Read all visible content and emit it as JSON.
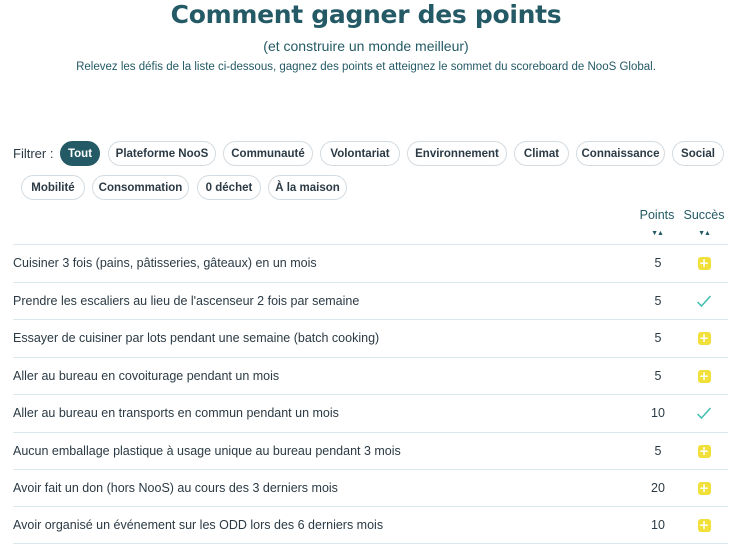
{
  "header": {
    "title": "Comment gagner des points",
    "subtitle": "(et construire un monde meilleur)",
    "description": "Relevez les défis de la liste ci-dessous, gagnez des points et atteignez le sommet du scoreboard de NooS Global."
  },
  "filter": {
    "label": "Filtrer :",
    "chips": [
      {
        "label": "Tout",
        "active": true
      },
      {
        "label": "Plateforme NooS"
      },
      {
        "label": "Communauté"
      },
      {
        "label": "Volontariat"
      },
      {
        "label": "Environnement"
      },
      {
        "label": "Climat"
      },
      {
        "label": "Connaissance"
      },
      {
        "label": "Social"
      },
      {
        "label": "Mobilité"
      },
      {
        "label": "Consommation"
      },
      {
        "label": "0 déchet"
      },
      {
        "label": "À la maison"
      }
    ]
  },
  "table": {
    "col_points": "Points",
    "col_success": "Succès",
    "sort_glyph": "▼▲",
    "rows": [
      {
        "name": "Cuisiner 3 fois (pains, pâtisseries, gâteaux) en un mois",
        "points": "5",
        "status": "plus"
      },
      {
        "name": "Prendre les escaliers au lieu de l'ascenseur 2 fois par semaine",
        "points": "5",
        "status": "check"
      },
      {
        "name": "Essayer de cuisiner par lots pendant une semaine (batch cooking)",
        "points": "5",
        "status": "plus"
      },
      {
        "name": "Aller au bureau en covoiturage pendant un mois",
        "points": "5",
        "status": "plus"
      },
      {
        "name": "Aller au bureau en transports en commun pendant un mois",
        "points": "10",
        "status": "check"
      },
      {
        "name": "Aucun emballage plastique à usage unique au bureau pendant 3 mois",
        "points": "5",
        "status": "plus"
      },
      {
        "name": "Avoir fait un don (hors NooS) au cours des 3 derniers mois",
        "points": "20",
        "status": "plus"
      },
      {
        "name": "Avoir organisé un événement sur les ODD lors des 6 derniers mois",
        "points": "10",
        "status": "plus"
      }
    ],
    "icons": {
      "plus": "plus-icon",
      "check": "check-icon"
    },
    "colors": {
      "accent": "#245a66",
      "plus": "#f2e03a",
      "check": "#3fbfb0"
    }
  }
}
